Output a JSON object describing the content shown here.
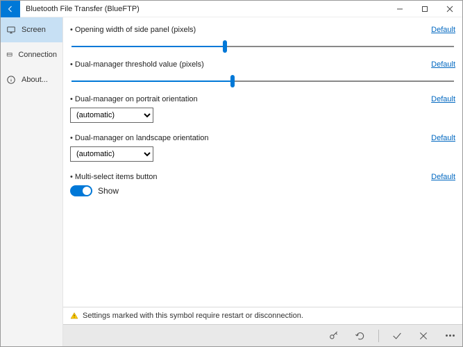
{
  "window": {
    "title": "Bluetooth File Transfer (BlueFTP)"
  },
  "sidebar": {
    "items": [
      {
        "label": "Screen",
        "icon": "monitor-icon",
        "active": true
      },
      {
        "label": "Connection",
        "icon": "connection-icon",
        "active": false
      },
      {
        "label": "About...",
        "icon": "info-icon",
        "active": false
      }
    ]
  },
  "settings": {
    "default_label": "Default",
    "items": [
      {
        "key": "opening_width",
        "type": "slider",
        "label": "Opening width of side panel (pixels)",
        "value_pct": 40
      },
      {
        "key": "dual_threshold",
        "type": "slider",
        "label": "Dual-manager threshold value (pixels)",
        "value_pct": 42
      },
      {
        "key": "dual_portrait",
        "type": "select",
        "label": "Dual-manager on portrait orientation",
        "value": "(automatic)",
        "options": [
          "(automatic)"
        ]
      },
      {
        "key": "dual_landscape",
        "type": "select",
        "label": "Dual-manager on landscape orientation",
        "value": "(automatic)",
        "options": [
          "(automatic)"
        ]
      },
      {
        "key": "multiselect",
        "type": "toggle",
        "label": "Multi-select items button",
        "on": true,
        "on_label": "Show"
      }
    ]
  },
  "notice": {
    "text": "Settings marked with this symbol require restart or disconnection."
  },
  "footer": {
    "buttons": [
      "edit",
      "undo",
      "apply",
      "cancel",
      "more"
    ]
  }
}
